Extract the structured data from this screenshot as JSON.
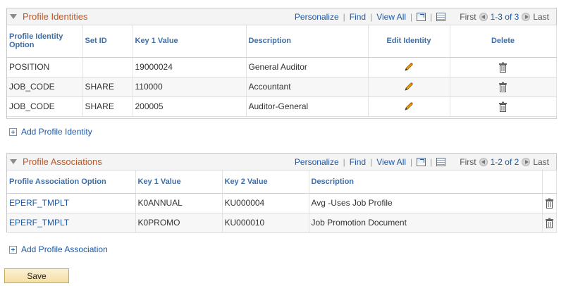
{
  "identities": {
    "title": "Profile Identities",
    "toolbar": {
      "personalize": "Personalize",
      "find": "Find",
      "view_all": "View All",
      "first": "First",
      "range": "1-3 of 3",
      "last": "Last"
    },
    "columns": [
      "Profile Identity Option",
      "Set ID",
      "Key 1 Value",
      "Description",
      "Edit Identity",
      "Delete"
    ],
    "rows": [
      {
        "option": "POSITION",
        "setid": "",
        "key1": "19000024",
        "description": "General Auditor"
      },
      {
        "option": "JOB_CODE",
        "setid": "SHARE",
        "key1": "110000",
        "description": "Accountant"
      },
      {
        "option": "JOB_CODE",
        "setid": "SHARE",
        "key1": "200005",
        "description": "Auditor-General"
      }
    ],
    "add_label": "Add Profile Identity"
  },
  "associations": {
    "title": "Profile Associations",
    "toolbar": {
      "personalize": "Personalize",
      "find": "Find",
      "view_all": "View All",
      "first": "First",
      "range": "1-2 of 2",
      "last": "Last"
    },
    "columns": [
      "Profile Association Option",
      "Key 1 Value",
      "Key 2 Value",
      "Description"
    ],
    "rows": [
      {
        "option": "EPERF_TMPLT",
        "key1": "K0ANNUAL",
        "key2": "KU000004",
        "description": "Avg -Uses Job Profile"
      },
      {
        "option": "EPERF_TMPLT",
        "key1": "K0PROMO",
        "key2": "KU000010",
        "description": "Job Promotion Document"
      }
    ],
    "add_label": "Add Profile Association"
  },
  "save_label": "Save",
  "colors": {
    "title_orange": "#c8561e",
    "link_blue": "#1d59a8",
    "header_blue": "#3d6ea8",
    "pencil": "#e8a20c"
  }
}
